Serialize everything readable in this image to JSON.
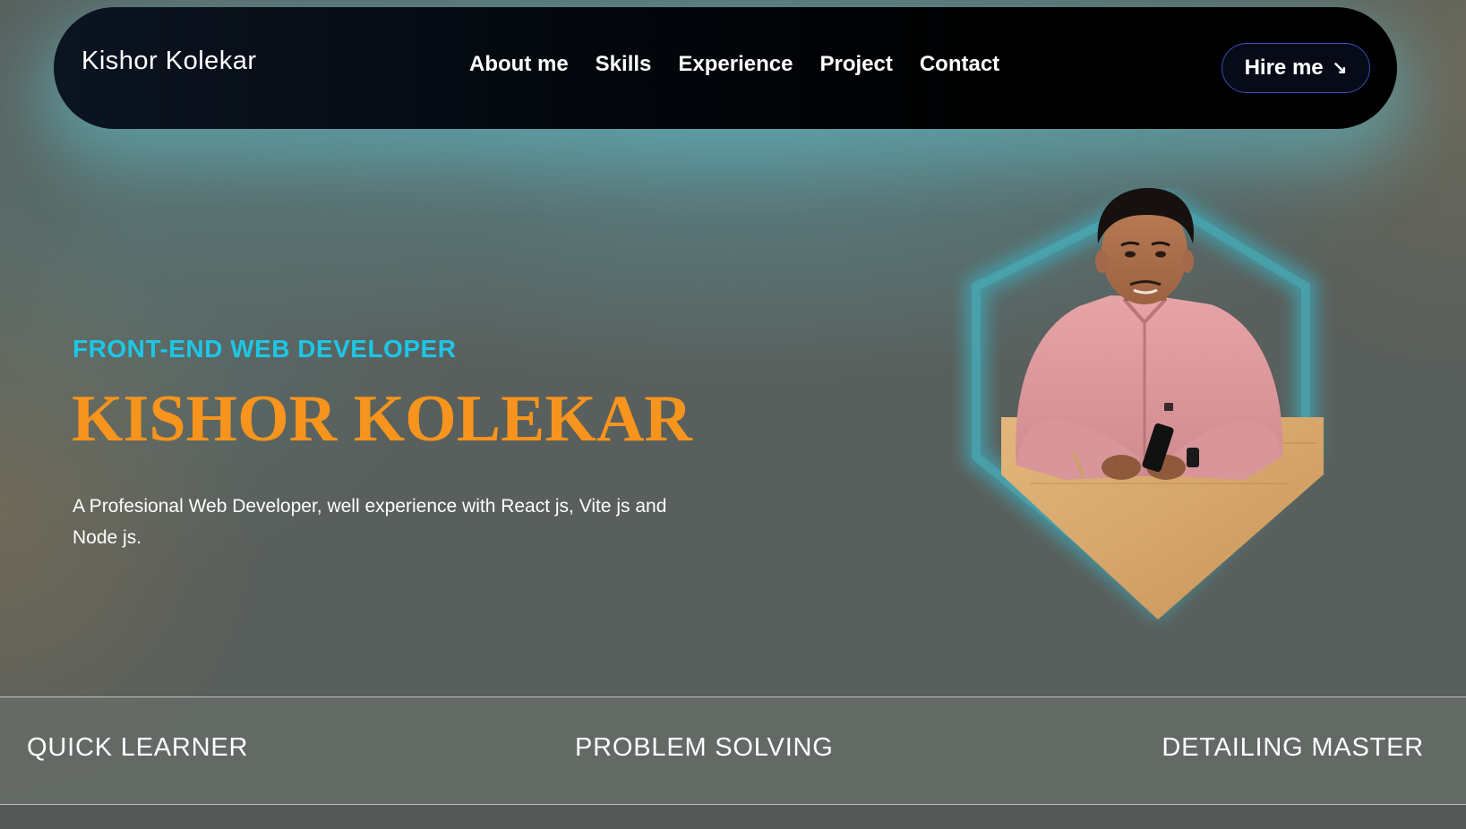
{
  "nav": {
    "brand": "Kishor Kolekar",
    "links": [
      "About me",
      "Skills",
      "Experience",
      "Project",
      "Contact"
    ],
    "hire_label": "Hire me",
    "hire_icon": "arrow-down-right-icon"
  },
  "hero": {
    "role": "FRONT-END WEB DEVELOPER",
    "name": "KISHOR KOLEKAR",
    "description": "A Profesional Web Developer, well experience with React js, Vite js and Node js."
  },
  "strengths": [
    "QUICK LEARNER",
    "PROBLEM SOLVING",
    "DETAILING MASTER"
  ],
  "colors": {
    "accent_cyan": "#1ec6e6",
    "accent_orange": "#f7941d",
    "nav_bg": "#000000",
    "page_bg": "#595f5c",
    "glow": "#5fafb9",
    "hire_border": "#3a4eb8"
  }
}
